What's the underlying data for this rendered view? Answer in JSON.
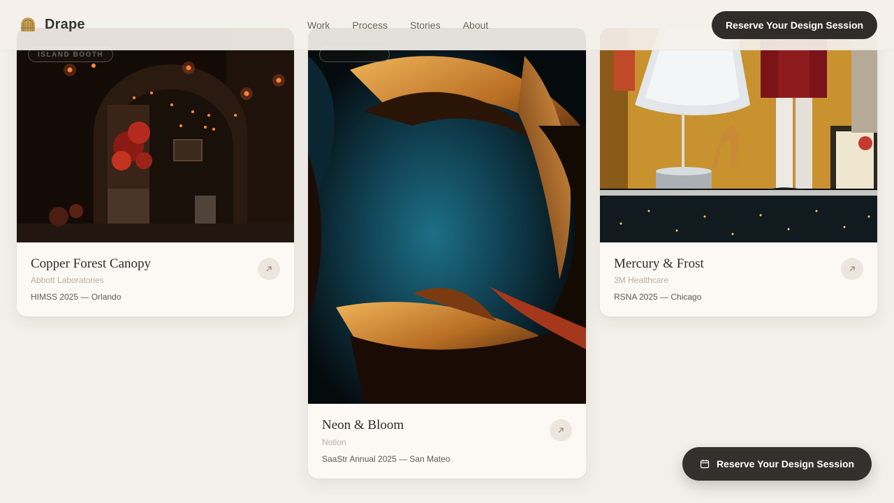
{
  "brand": {
    "name": "Drape",
    "logo_icon": "arch-logo-icon"
  },
  "nav": {
    "items": [
      "Work",
      "Process",
      "Stories",
      "About"
    ]
  },
  "header_cta": {
    "label": "Reserve Your Design Session"
  },
  "cards": [
    {
      "tag": "ISLAND BOOTH",
      "title": "Copper Forest Canopy",
      "client": "Abbott Laboratories",
      "event": "HIMSS 2025 — Orlando",
      "image": "warm-lit-archway-photo",
      "arrow_icon": "arrow-up-right-icon"
    },
    {
      "tag": "",
      "title": "Neon & Bloom",
      "client": "Notion",
      "event": "SaaStr Annual 2025 — San Mateo",
      "image": "abstract-copper-ribbons-photo",
      "arrow_icon": "arrow-up-right-icon"
    },
    {
      "title": "Mercury & Frost",
      "client": "3M Healthcare",
      "event": "RSNA 2025 — Chicago",
      "image": "holiday-window-display-photo",
      "arrow_icon": "arrow-up-right-icon"
    }
  ],
  "floating_cta": {
    "label": "Reserve Your Design Session",
    "icon": "calendar-icon"
  },
  "colors": {
    "background": "#f3efea",
    "card": "#fcf9f5",
    "button": "#2f2c29",
    "accent": "#c9a15a"
  }
}
